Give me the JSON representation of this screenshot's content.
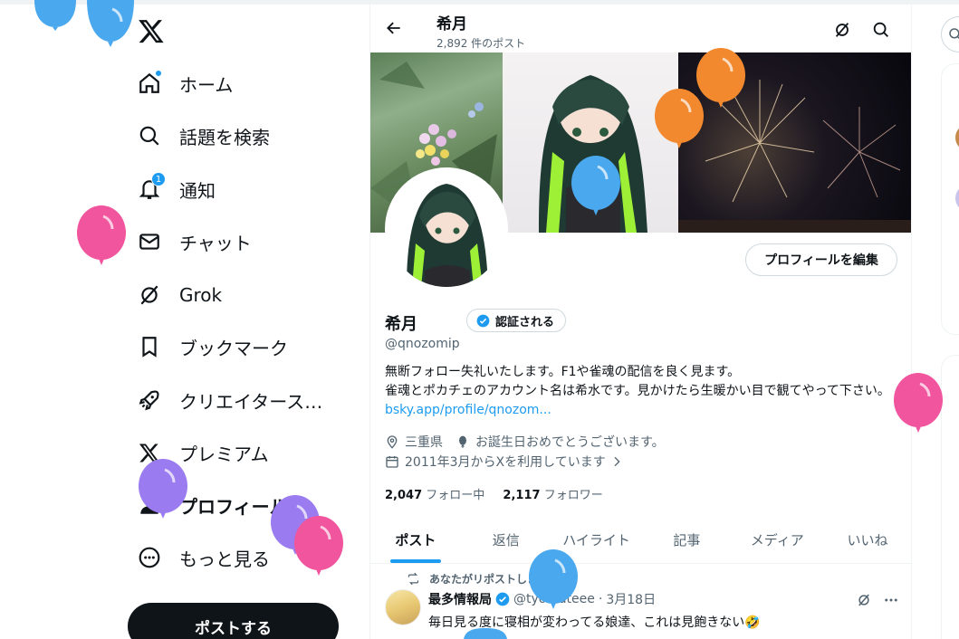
{
  "sidebar": {
    "items": [
      {
        "label": "ホーム",
        "icon": "home-icon"
      },
      {
        "label": "話題を検索",
        "icon": "search-icon"
      },
      {
        "label": "通知",
        "icon": "bell-icon",
        "badge": "1"
      },
      {
        "label": "チャット",
        "icon": "mail-icon"
      },
      {
        "label": "Grok",
        "icon": "grok-icon"
      },
      {
        "label": "ブックマーク",
        "icon": "bookmark-icon"
      },
      {
        "label": "クリエイタース…",
        "icon": "rocket-icon"
      },
      {
        "label": "プレミアム",
        "icon": "x-logo-icon"
      },
      {
        "label": "プロフィール",
        "icon": "person-icon"
      },
      {
        "label": "もっと見る",
        "icon": "more-circle-icon"
      }
    ],
    "post_button": "ポストする"
  },
  "header": {
    "name": "希月",
    "post_count": "2,892 件のポスト"
  },
  "profile": {
    "edit_button": "プロフィールを編集",
    "name": "希月",
    "verified_label": "認証される",
    "handle": "@qnozomip",
    "bio_line1": "無断フォロー失礼いたします。F1や雀魂の配信を良く見ます。",
    "bio_line2": "雀魂とポカチェのアカウント名は希水です。見かけたら生暖かい目で観てやって下さい。",
    "bio_link": "bsky.app/profile/qnozom...",
    "location": "三重県",
    "birthday": "お誕生日おめでとうございます。",
    "joined": "2011年3月からXを利用しています",
    "following_count": "2,047",
    "following_label": "フォロー中",
    "followers_count": "2,117",
    "followers_label": "フォロワー"
  },
  "tabs": [
    "ポスト",
    "返信",
    "ハイライト",
    "記事",
    "メディア",
    "いいね"
  ],
  "tweet": {
    "repost_label": "あなたがリポストしました",
    "author": "最多情報局",
    "handle": "@tyomateee",
    "date": "3月18日",
    "text": "毎日見る度に寝相が変わってる娘達、これは見飽きない🤣"
  },
  "colors": {
    "accent": "#1d9bf0",
    "text": "#0f1419",
    "muted": "#536471",
    "balloon_blue": "#4aa8ee",
    "balloon_pink": "#f0559e",
    "balloon_purple": "#9b7cf0",
    "balloon_orange": "#f2892f"
  }
}
